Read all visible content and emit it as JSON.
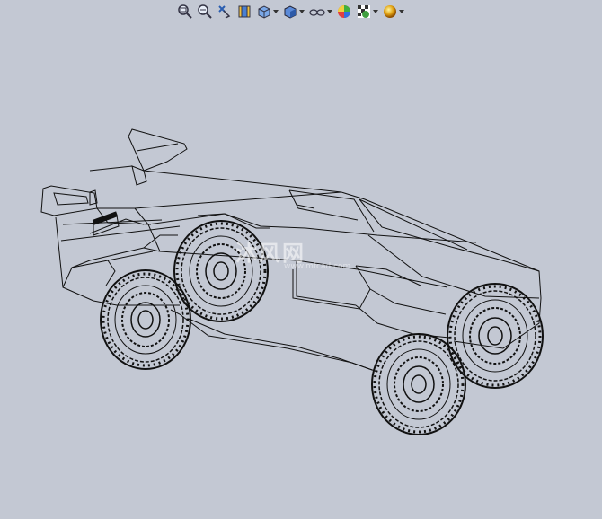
{
  "toolbar": {
    "buttons": [
      {
        "icon": "zoom-to-fit-icon",
        "dropdown": false
      },
      {
        "icon": "zoom-to-area-icon",
        "dropdown": false
      },
      {
        "icon": "previous-view-icon",
        "dropdown": false
      },
      {
        "icon": "section-view-icon",
        "dropdown": false
      },
      {
        "icon": "view-orientation-icon",
        "dropdown": true
      },
      {
        "icon": "display-style-icon",
        "dropdown": true
      },
      {
        "icon": "hide-show-items-icon",
        "dropdown": true
      },
      {
        "icon": "edit-appearance-icon",
        "dropdown": false
      },
      {
        "icon": "apply-scene-icon",
        "dropdown": true
      },
      {
        "icon": "view-settings-icon",
        "dropdown": true
      }
    ]
  },
  "viewport": {
    "model": "wireframe-vehicle",
    "background": "#c3c8d3",
    "line_color": "#111111"
  },
  "watermark": {
    "text": "沐风网",
    "subtext": "www.mfcad.com"
  }
}
